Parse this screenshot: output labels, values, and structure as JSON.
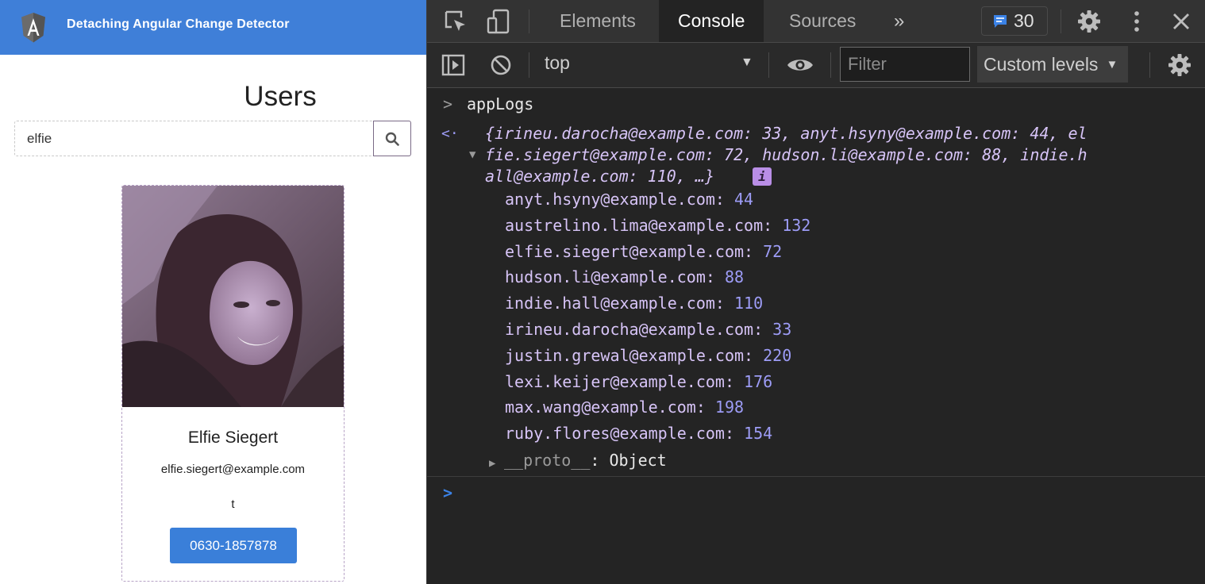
{
  "app": {
    "title": "Detaching Angular Change Detector",
    "heading": "Users",
    "search": {
      "value": "elfie",
      "placeholder": ""
    },
    "user": {
      "name": "Elfie Siegert",
      "email": "elfie.siegert@example.com",
      "extra": "t",
      "phone": "0630-1857878"
    }
  },
  "devtools": {
    "tabs": [
      "Elements",
      "Console",
      "Sources"
    ],
    "more_tabs": "»",
    "issues_count": "30",
    "context": "top",
    "filter_placeholder": "Filter",
    "levels": "Custom levels",
    "console": {
      "input": "appLogs",
      "summary": [
        "{irineu.darocha@example.com: 33, anyt.hsyny@example.com: 44, el",
        "fie.siegert@example.com: 72, hudson.li@example.com: 88, indie.h",
        "all@example.com: 110, …}"
      ],
      "info_badge": "i",
      "entries": [
        {
          "key": "anyt.hsyny@example.com",
          "value": "44"
        },
        {
          "key": "austrelino.lima@example.com",
          "value": "132"
        },
        {
          "key": "elfie.siegert@example.com",
          "value": "72"
        },
        {
          "key": "hudson.li@example.com",
          "value": "88"
        },
        {
          "key": "indie.hall@example.com",
          "value": "110"
        },
        {
          "key": "irineu.darocha@example.com",
          "value": "33"
        },
        {
          "key": "justin.grewal@example.com",
          "value": "220"
        },
        {
          "key": "lexi.keijer@example.com",
          "value": "176"
        },
        {
          "key": "max.wang@example.com",
          "value": "198"
        },
        {
          "key": "ruby.flores@example.com",
          "value": "154"
        }
      ],
      "proto_key": "__proto__",
      "proto_value": "Object"
    }
  },
  "colors": {
    "app_header": "#3f7fd8",
    "primary_button": "#3a7fd9",
    "devtools_bg": "#242424",
    "property_key": "#d7c4f7",
    "property_value": "#9d9cf6"
  },
  "icons": {
    "app_logo": "angular-logo-icon",
    "search": "search-icon",
    "inspect": "inspect-element-icon",
    "device": "device-toggle-icon",
    "sidebar": "console-sidebar-icon",
    "clear": "clear-console-icon",
    "eye": "live-expression-icon",
    "settings": "gear-icon",
    "menu": "kebab-menu-icon",
    "close": "close-icon"
  }
}
